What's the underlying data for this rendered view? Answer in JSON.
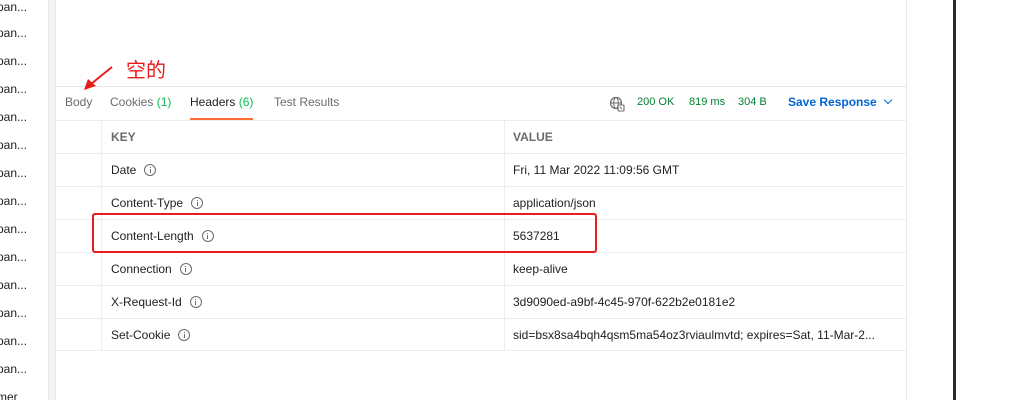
{
  "sidebar": {
    "items": [
      "pan...",
      "pan...",
      "pan...",
      "pan...",
      "pan...",
      "pan...",
      "pan...",
      "pan...",
      "pan...",
      "pan...",
      "pan...",
      "pan...",
      "pan...",
      "pan...",
      "mer"
    ]
  },
  "annotation": {
    "text": "空的",
    "color": "#e81c1c"
  },
  "tabs": [
    {
      "label": "Body",
      "count": ""
    },
    {
      "label": "Cookies",
      "count": "(1)"
    },
    {
      "label": "Headers",
      "count": "(6)"
    },
    {
      "label": "Test Results",
      "count": ""
    }
  ],
  "status": {
    "code": "200 OK",
    "time": "819 ms",
    "size": "304 B",
    "color": "#007f31"
  },
  "save_response": {
    "label": "Save Response",
    "icon": "chevron-down-icon"
  },
  "table": {
    "headers": {
      "key": "KEY",
      "value": "VALUE"
    },
    "rows": [
      {
        "key": "Date",
        "value": "Fri, 11 Mar 2022 11:09:56 GMT"
      },
      {
        "key": "Content-Type",
        "value": "application/json"
      },
      {
        "key": "Content-Length",
        "value": "5637281"
      },
      {
        "key": "Connection",
        "value": "keep-alive"
      },
      {
        "key": "X-Request-Id",
        "value": "3d9090ed-a9bf-4c45-970f-622b2e0181e2"
      },
      {
        "key": "Set-Cookie",
        "value": "sid=bsx8sa4bqh4qsm5ma54oz3rviaulmvtd; expires=Sat, 11-Mar-2..."
      }
    ]
  },
  "colors": {
    "accent_tab": "#ff6c37",
    "link": "#0265d2",
    "count": "#0cbb52"
  }
}
